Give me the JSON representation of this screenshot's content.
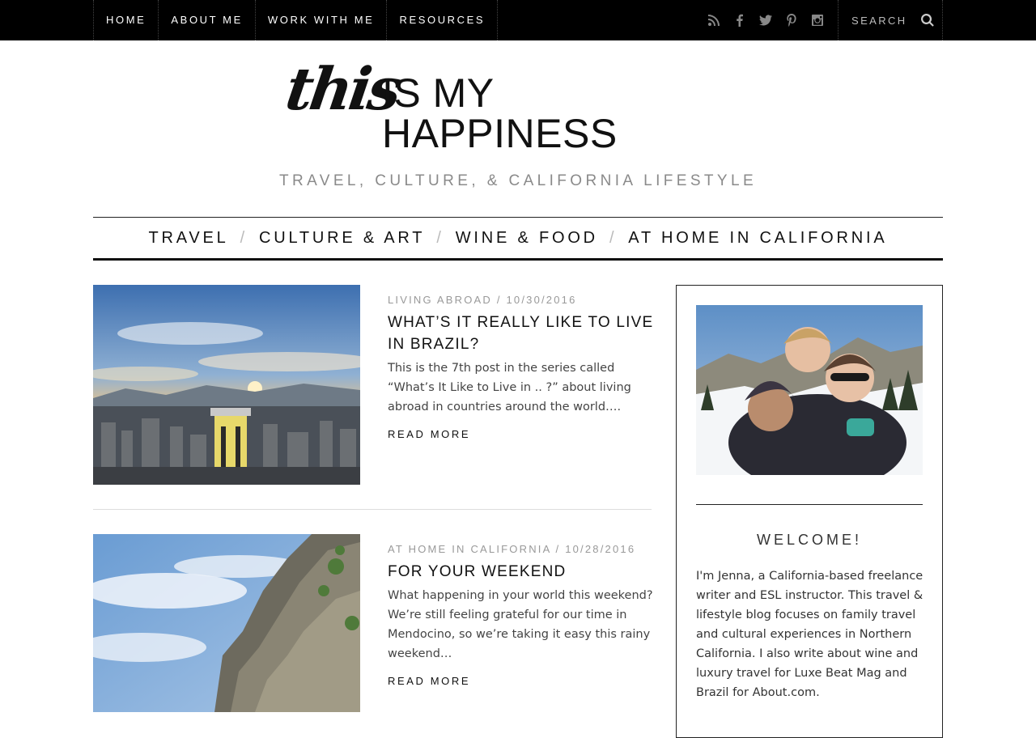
{
  "topnav": {
    "items": [
      "HOME",
      "ABOUT ME",
      "WORK WITH ME",
      "RESOURCES"
    ]
  },
  "social": {
    "icons": [
      "rss-icon",
      "facebook-icon",
      "twitter-icon",
      "pinterest-icon",
      "instagram-icon"
    ]
  },
  "search": {
    "placeholder": "SEARCH"
  },
  "header": {
    "logo_script": "this",
    "logo_main": "IS MY HAPPINESS",
    "tagline": "TRAVEL, CULTURE, & CALIFORNIA LIFESTYLE"
  },
  "catnav": {
    "items": [
      "TRAVEL",
      "CULTURE & ART",
      "WINE & FOOD",
      "AT HOME IN CALIFORNIA"
    ],
    "separator": "/"
  },
  "posts": [
    {
      "category": "LIVING ABROAD",
      "date": "10/30/2016",
      "title": "WHAT’S IT REALLY LIKE TO LIVE IN BRAZIL?",
      "excerpt": "This is the 7th post in the series called “What’s It Like to Live in .. ?” about living abroad in countries around the world….",
      "read_more": "READ MORE"
    },
    {
      "category": "AT HOME IN CALIFORNIA",
      "date": "10/28/2016",
      "title": "FOR YOUR WEEKEND",
      "excerpt": "What happening in your world this weekend? We’re still feeling grateful for our time in Mendocino, so we’re taking it easy this rainy weekend…",
      "read_more": "READ MORE"
    }
  ],
  "sidebar": {
    "welcome_title": "WELCOME!",
    "welcome_text": "I'm Jenna, a California-based freelance writer and ESL instructor. This travel & lifestyle blog focuses on family travel and cultural experiences in Northern California. I also write about wine and luxury travel for Luxe Beat Mag and Brazil for About.com."
  },
  "meta_separator": " / ",
  "colors": {
    "topbar_bg": "#000000",
    "accent_text": "#999999"
  }
}
